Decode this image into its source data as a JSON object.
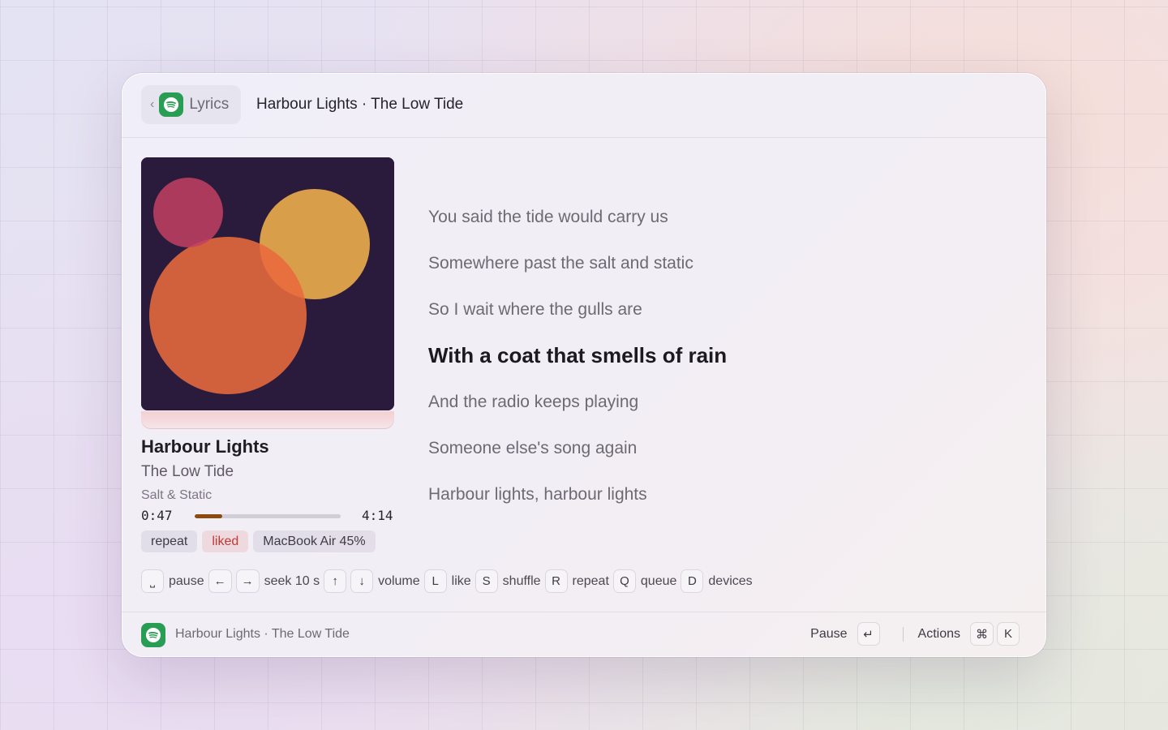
{
  "header": {
    "back_label": "Lyrics",
    "back_chevron": "‹",
    "title": "Harbour Lights · The Low Tide"
  },
  "track": {
    "name": "Harbour Lights",
    "artist": "The Low Tide",
    "album": "Salt & Static",
    "elapsed": "0:47",
    "duration": "4:14",
    "progress_fraction": 0.19
  },
  "tags": [
    "repeat",
    "liked",
    "MacBook Air 45%"
  ],
  "lyrics": [
    {
      "text": "You said the tide would carry us",
      "current": false
    },
    {
      "text": "Somewhere past the salt and static",
      "current": false
    },
    {
      "text": "So I wait where the gulls are",
      "current": false
    },
    {
      "text": "With a coat that smells of rain",
      "current": true
    },
    {
      "text": "And the radio keeps playing",
      "current": false
    },
    {
      "text": "Someone else's song again",
      "current": false
    },
    {
      "text": "Harbour lights, harbour lights",
      "current": false
    }
  ],
  "shortcuts": [
    {
      "keys": [
        "⎵"
      ],
      "label": "pause"
    },
    {
      "keys": [
        "←",
        "→"
      ],
      "label": "seek 10 s"
    },
    {
      "keys": [
        "↑",
        "↓"
      ],
      "label": "volume"
    },
    {
      "keys": [
        "L"
      ],
      "label": "like"
    },
    {
      "keys": [
        "S"
      ],
      "label": "shuffle"
    },
    {
      "keys": [
        "R"
      ],
      "label": "repeat"
    },
    {
      "keys": [
        "Q"
      ],
      "label": "queue"
    },
    {
      "keys": [
        "D"
      ],
      "label": "devices"
    }
  ],
  "footer": {
    "now_playing": "Harbour Lights · The Low Tide",
    "primary_action": "Pause",
    "primary_key": "↵",
    "actions_label": "Actions",
    "actions_keys": [
      "⌘",
      "K"
    ]
  },
  "colors": {
    "app_icon": "#2a9d55",
    "progress_fill": "#8c4a0e",
    "liked": "#c03a35",
    "art_background": "#2a1b3d"
  },
  "icons": {
    "app": "spotify-icon",
    "back": "chevron-left-icon"
  }
}
